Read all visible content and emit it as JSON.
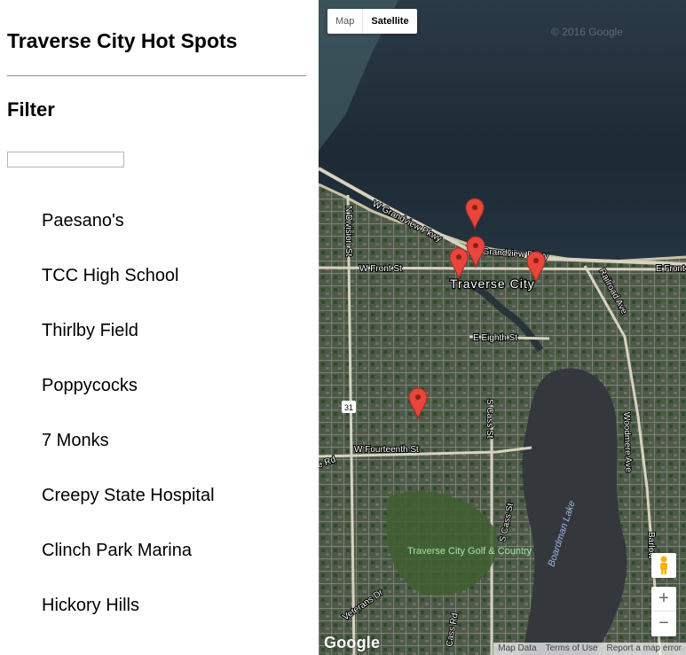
{
  "sidebar": {
    "title": "Traverse City Hot Spots",
    "filter_heading": "Filter",
    "filter_input_value": "",
    "places": [
      "Paesano's",
      "TCC High School",
      "Thirlby Field",
      "Poppycocks",
      "7 Monks",
      "Creepy State Hospital",
      "Clinch Park Marina",
      "Hickory Hills"
    ]
  },
  "map": {
    "map_type_map": "Map",
    "map_type_satellite": "Satellite",
    "selected_map_type": "Satellite",
    "copyright": "© 2016 Google",
    "google_logo": "Google",
    "attribution": [
      "Map Data",
      "Terms of Use",
      "Report a map error"
    ],
    "zoom_in": "+",
    "zoom_out": "−",
    "labels": {
      "city": "Traverse City",
      "grandview": "W Grandview Pkwy",
      "grandview_e": "E Grandview Pkwy",
      "front_w": "W Front St",
      "front_e": "E Front",
      "division": "N Division St",
      "railroad": "Railroad Ave",
      "eighth": "E Eighth St",
      "cass_n": "S Cass St",
      "cass_s": "S Cass St",
      "cass_rd": "Cass Rd",
      "fourteenth": "W Fourteenth St",
      "route": "31",
      "woodmere": "Woodmere Ave",
      "boardman": "Boardman Lake",
      "golf": "Traverse City Golf & Country",
      "veterans": "Veterans Dr",
      "barlow": "Barlow",
      "ave_rd": "e Rd"
    },
    "marker_color": "#e8453c",
    "marker_count": 5
  }
}
